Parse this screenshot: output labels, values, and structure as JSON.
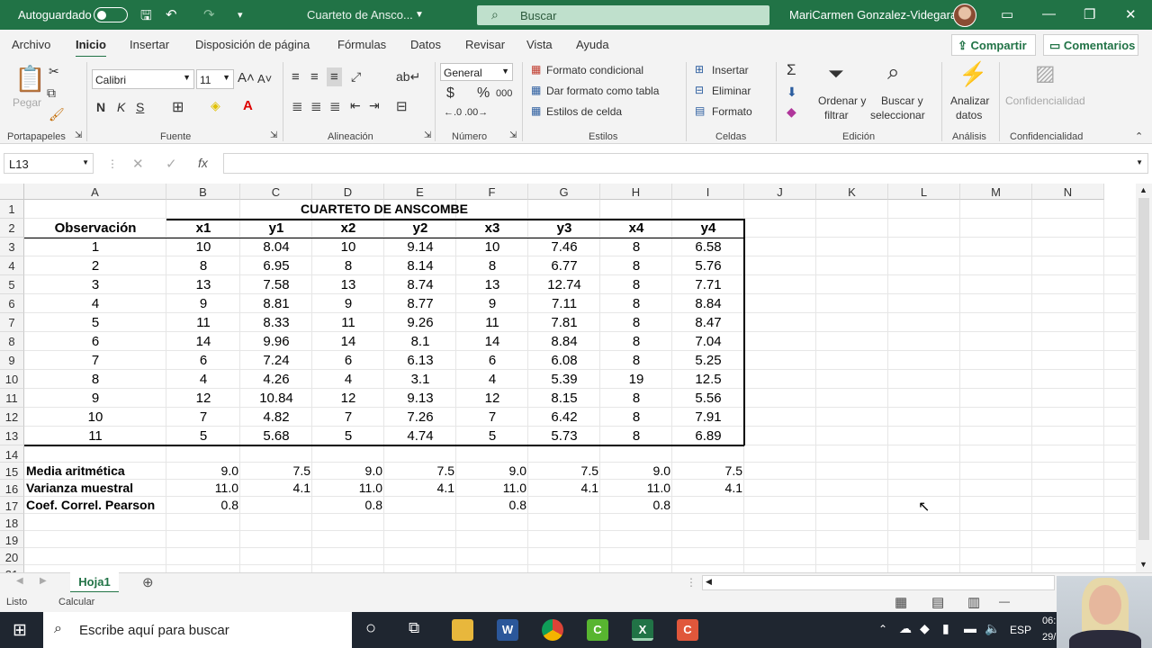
{
  "titlebar": {
    "autosave_label": "Autoguardado",
    "doc_title": "Cuarteto de Ansco...",
    "search_placeholder": "Buscar",
    "user_name": "MariCarmen Gonzalez-Videgaray"
  },
  "menu": {
    "tabs": [
      "Archivo",
      "Inicio",
      "Insertar",
      "Disposición de página",
      "Fórmulas",
      "Datos",
      "Revisar",
      "Vista",
      "Ayuda"
    ],
    "active": "Inicio",
    "share_label": "Compartir",
    "comments_label": "Comentarios"
  },
  "ribbon": {
    "clipboard": {
      "paste": "Pegar",
      "label": "Portapapeles"
    },
    "font": {
      "name": "Calibri",
      "size": "11",
      "label": "Fuente",
      "bold": "N",
      "italic": "K",
      "underline": "S"
    },
    "alignment": {
      "label": "Alineación"
    },
    "number": {
      "format": "General",
      "label": "Número",
      "percent": "%",
      "thousands": "000"
    },
    "styles": {
      "cond_format": "Formato condicional",
      "table_format": "Dar formato como tabla",
      "cell_styles": "Estilos de celda",
      "label": "Estilos"
    },
    "cells": {
      "insert": "Insertar",
      "delete": "Eliminar",
      "format": "Formato",
      "label": "Celdas"
    },
    "editing": {
      "sort_1": "Ordenar y",
      "sort_2": "filtrar",
      "find_1": "Buscar y",
      "find_2": "seleccionar",
      "label": "Edición"
    },
    "analysis": {
      "analyze_1": "Analizar",
      "analyze_2": "datos",
      "label": "Análisis"
    },
    "confidentiality": {
      "btn": "Confidencialidad",
      "label": "Confidencialidad"
    }
  },
  "formula_bar": {
    "name_box": "L13",
    "fx": "fx",
    "content": ""
  },
  "sheet": {
    "columns": [
      "A",
      "B",
      "C",
      "D",
      "E",
      "F",
      "G",
      "H",
      "I",
      "J",
      "K",
      "L",
      "M",
      "N"
    ],
    "rows": [
      "1",
      "2",
      "3",
      "4",
      "5",
      "6",
      "7",
      "8",
      "9",
      "10",
      "11",
      "12",
      "13",
      "14",
      "15",
      "16",
      "17",
      "18",
      "19",
      "20",
      "21"
    ],
    "title": "CUARTETO DE ANSCOMBE",
    "headers": [
      "Observación",
      "x1",
      "y1",
      "x2",
      "y2",
      "x3",
      "y3",
      "x4",
      "y4"
    ],
    "data": [
      [
        "1",
        "10",
        "8.04",
        "10",
        "9.14",
        "10",
        "7.46",
        "8",
        "6.58"
      ],
      [
        "2",
        "8",
        "6.95",
        "8",
        "8.14",
        "8",
        "6.77",
        "8",
        "5.76"
      ],
      [
        "3",
        "13",
        "7.58",
        "13",
        "8.74",
        "13",
        "12.74",
        "8",
        "7.71"
      ],
      [
        "4",
        "9",
        "8.81",
        "9",
        "8.77",
        "9",
        "7.11",
        "8",
        "8.84"
      ],
      [
        "5",
        "11",
        "8.33",
        "11",
        "9.26",
        "11",
        "7.81",
        "8",
        "8.47"
      ],
      [
        "6",
        "14",
        "9.96",
        "14",
        "8.1",
        "14",
        "8.84",
        "8",
        "7.04"
      ],
      [
        "7",
        "6",
        "7.24",
        "6",
        "6.13",
        "6",
        "6.08",
        "8",
        "5.25"
      ],
      [
        "8",
        "4",
        "4.26",
        "4",
        "3.1",
        "4",
        "5.39",
        "19",
        "12.5"
      ],
      [
        "9",
        "12",
        "10.84",
        "12",
        "9.13",
        "12",
        "8.15",
        "8",
        "5.56"
      ],
      [
        "10",
        "7",
        "4.82",
        "7",
        "7.26",
        "7",
        "6.42",
        "8",
        "7.91"
      ],
      [
        "11",
        "5",
        "5.68",
        "5",
        "4.74",
        "5",
        "5.73",
        "8",
        "6.89"
      ]
    ],
    "stats": [
      {
        "label": "Media aritmética",
        "values": [
          "9.0",
          "7.5",
          "9.0",
          "7.5",
          "9.0",
          "7.5",
          "9.0",
          "7.5"
        ]
      },
      {
        "label": "Varianza muestral",
        "values": [
          "11.0",
          "4.1",
          "11.0",
          "4.1",
          "11.0",
          "4.1",
          "11.0",
          "4.1"
        ]
      },
      {
        "label": "Coef. Correl. Pearson",
        "values": [
          "0.8",
          "",
          "0.8",
          "",
          "0.8",
          "",
          "0.8",
          ""
        ]
      }
    ]
  },
  "tabs": {
    "sheet_name": "Hoja1"
  },
  "status": {
    "ready": "Listo",
    "calc": "Calcular"
  },
  "taskbar": {
    "search_placeholder": "Escribe aquí para buscar",
    "lang": "ESP",
    "time": "06:",
    "date": "29/"
  }
}
